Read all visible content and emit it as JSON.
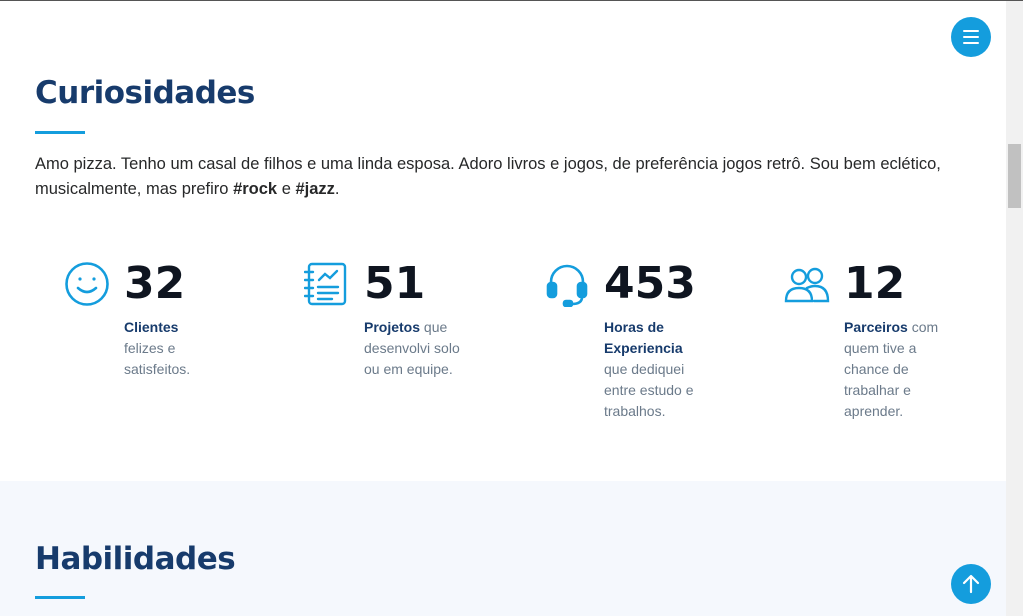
{
  "curiosidades": {
    "title": "Curiosidades",
    "intro_text": "Amo pizza. Tenho um casal de filhos e uma linda esposa. Adoro livros e jogos, de preferência jogos retrô. Sou bem eclético, musicalmente, mas prefiro ",
    "tag_rock": "#rock",
    "connector": " e ",
    "tag_jazz": "#jazz",
    "end": "."
  },
  "stats": [
    {
      "icon": "smiley-icon",
      "number": "32",
      "label": "Clientes",
      "text": " felizes e satisfeitos."
    },
    {
      "icon": "journal-icon",
      "number": "51",
      "label": "Projetos",
      "text": " que desenvolvi solo ou em equipe."
    },
    {
      "icon": "headset-icon",
      "number": "453",
      "label": "Horas de Experiencia",
      "text": " que dediquei entre estudo e trabalhos."
    },
    {
      "icon": "people-icon",
      "number": "12",
      "label": "Parceiros",
      "text": " com quem tive a chance de trabalhar e aprender."
    }
  ],
  "habilidades": {
    "title": "Habilidades"
  },
  "colors": {
    "accent": "#149ddd",
    "heading": "#173b6c",
    "section_alt_bg": "#f5f8fd"
  },
  "buttons": {
    "menu_icon": "menu-icon",
    "back_to_top_icon": "arrow-up-icon"
  }
}
